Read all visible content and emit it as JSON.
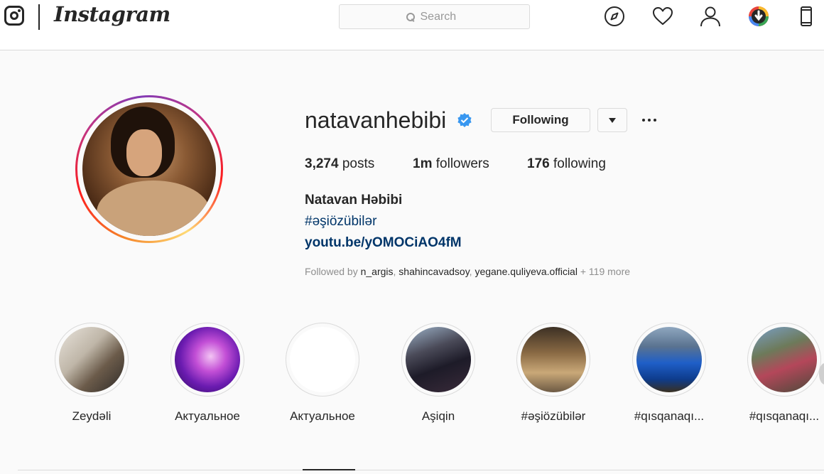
{
  "header": {
    "logo_text": "Instagram",
    "search": {
      "placeholder": "Search",
      "value": ""
    },
    "nav_icons": [
      "explore-compass-icon",
      "activity-heart-icon",
      "profile-person-icon",
      "downloader-extension-icon",
      "mobile-phone-icon"
    ]
  },
  "profile": {
    "username": "natavanhebibi",
    "verified": true,
    "follow_button_label": "Following",
    "stats": {
      "posts_count": "3,274",
      "posts_label": "posts",
      "followers_count": "1m",
      "followers_label": "followers",
      "following_count": "176",
      "following_label": "following"
    },
    "full_name": "Natavan Həbibi",
    "bio_hashtag": "#əşiözübilər",
    "bio_link": "youtu.be/yOMOCiAO4fM",
    "followed_by": {
      "prefix": "Followed by",
      "names": [
        "n_argis",
        "shahincavadsoy",
        "yegane.quliyeva.official"
      ],
      "more": "+ 119 more"
    }
  },
  "highlights": [
    {
      "label": "Zeydəli"
    },
    {
      "label": "Актуальное"
    },
    {
      "label": "Актуальное"
    },
    {
      "label": "Aşiqin"
    },
    {
      "label": "#əşiözübilər"
    },
    {
      "label": "#qısqanaqı..."
    },
    {
      "label": "#qısqanaqı..."
    }
  ],
  "colors": {
    "verified_blue": "#3897f0",
    "link_blue": "#003569",
    "text": "#262626",
    "secondary_text": "#8e8e8e",
    "border": "#dbdbdb",
    "background": "#fafafa"
  }
}
